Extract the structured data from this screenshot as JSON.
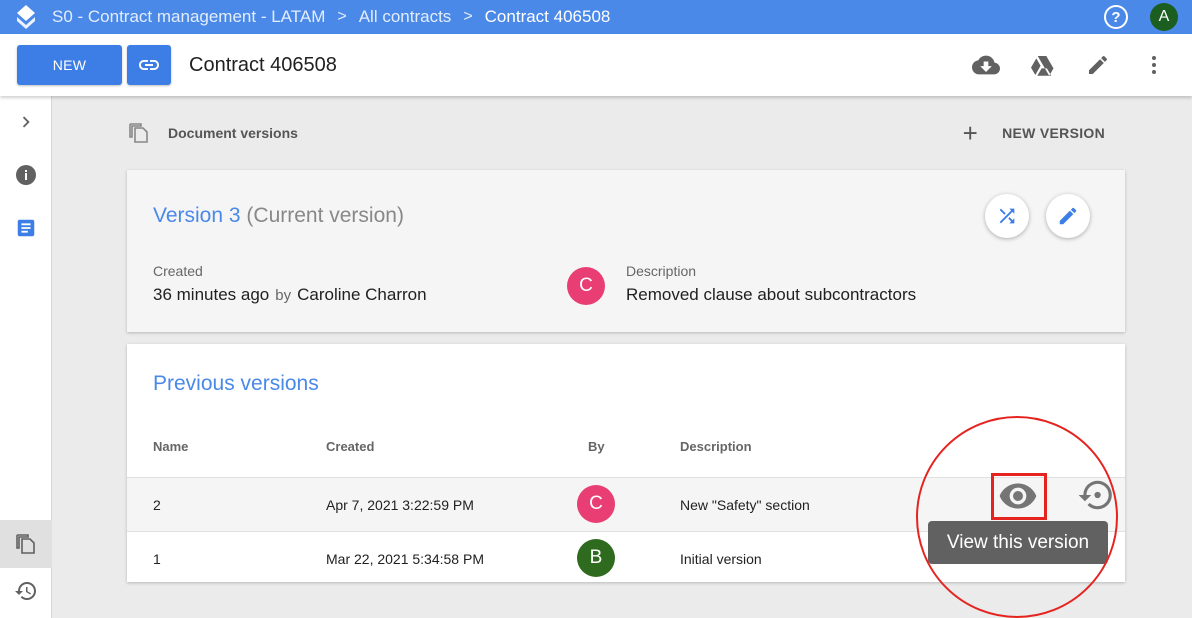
{
  "breadcrumb": {
    "items": [
      "S0 - Contract management - LATAM",
      "All contracts",
      "Contract 406508"
    ],
    "separator": ">"
  },
  "topbar": {
    "help_glyph": "?",
    "user_initial": "A"
  },
  "toolbar": {
    "new_label": "NEW",
    "title": "Contract 406508",
    "icons": [
      "link-icon",
      "cloud-download-icon",
      "google-drive-icon",
      "edit-icon",
      "more-vert-icon"
    ]
  },
  "sidebar": {
    "items": [
      "chevron-right-icon",
      "info-icon",
      "document-icon",
      "copy-versions-icon",
      "history-icon"
    ]
  },
  "versions_section": {
    "title": "Document versions",
    "new_version_label": "NEW VERSION",
    "new_version_glyph": "+"
  },
  "current_version": {
    "title": "Version 3",
    "subtitle": "(Current version)",
    "created_label": "Created",
    "created_value": "36 minutes ago",
    "by_label": "by",
    "author": "Caroline Charron",
    "avatar_initial": "C",
    "description_label": "Description",
    "description_value": "Removed clause about subcontractors"
  },
  "previous_versions": {
    "title": "Previous versions",
    "columns": [
      "Name",
      "Created",
      "By",
      "Description"
    ],
    "rows": [
      {
        "name": "2",
        "created": "Apr 7, 2021 3:22:59 PM",
        "by": "C",
        "description": "New \"Safety\" section"
      },
      {
        "name": "1",
        "created": "Mar 22, 2021 5:34:58 PM",
        "by": "B",
        "description": "Initial version"
      }
    ]
  },
  "tooltip": {
    "text": "View this version"
  },
  "colors": {
    "primary": "#4a89e8",
    "button": "#3d7ee6",
    "avatar_pink": "#e83e74",
    "avatar_green": "#2e6b1f",
    "avatar_user": "#1b5e20",
    "annotation_red": "#e52420",
    "tooltip_bg": "#616161"
  }
}
